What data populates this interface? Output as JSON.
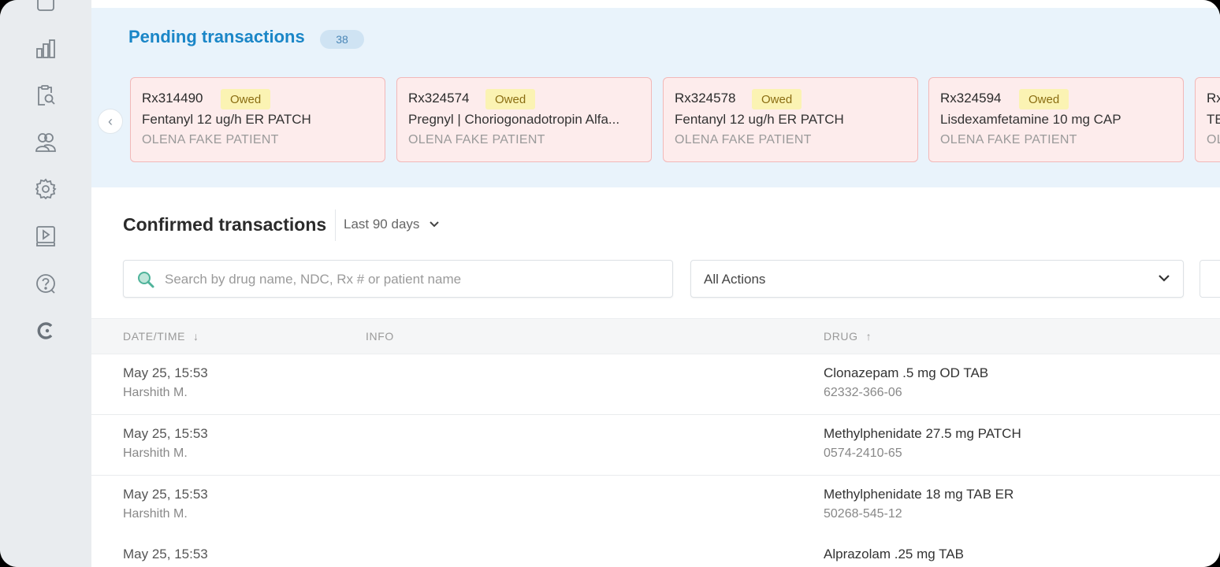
{
  "sidebar": {
    "icons": [
      "page-icon",
      "bar-chart-icon",
      "clipboard-search-icon",
      "users-icon",
      "gear-icon",
      "video-book-icon",
      "help-icon",
      "brand-logo-icon"
    ]
  },
  "pending": {
    "title": "Pending transactions",
    "count": "38",
    "cards": [
      {
        "rx": "Rx314490",
        "status": "Owed",
        "drug": "Fentanyl 12 ug/h ER PATCH",
        "patient": "OLENA FAKE PATIENT"
      },
      {
        "rx": "Rx324574",
        "status": "Owed",
        "drug": "Pregnyl | Choriogonadotropin Alfa...",
        "patient": "OLENA FAKE PATIENT"
      },
      {
        "rx": "Rx324578",
        "status": "Owed",
        "drug": "Fentanyl 12 ug/h ER PATCH",
        "patient": "OLENA FAKE PATIENT"
      },
      {
        "rx": "Rx324594",
        "status": "Owed",
        "drug": "Lisdexamfetamine 10 mg CAP",
        "patient": "OLENA FAKE PATIENT"
      },
      {
        "rx": "Rx",
        "status": "",
        "drug": "TE",
        "patient": "OL"
      }
    ]
  },
  "confirmed": {
    "title": "Confirmed transactions",
    "range": "Last 90 days",
    "search_placeholder": "Search by drug name, NDC, Rx # or patient name",
    "actions_filter": "All Actions",
    "columns": {
      "datetime": "DATE/TIME",
      "info": "INFO",
      "drug": "DRUG"
    },
    "rows": [
      {
        "datetime": "May 25, 15:53",
        "user": "Harshith M.",
        "drug": "Clonazepam .5 mg OD TAB",
        "ndc": "62332-366-06"
      },
      {
        "datetime": "May 25, 15:53",
        "user": "Harshith M.",
        "drug": "Methylphenidate 27.5 mg PATCH",
        "ndc": "0574-2410-65"
      },
      {
        "datetime": "May 25, 15:53",
        "user": "Harshith M.",
        "drug": "Methylphenidate 18 mg TAB ER",
        "ndc": "50268-545-12"
      },
      {
        "datetime": "May 25, 15:53",
        "user": "",
        "drug": "Alprazolam .25 mg TAB",
        "ndc": ""
      }
    ]
  },
  "colors": {
    "accent": "#1a86c7",
    "owed_bg": "#fbf3b3",
    "card_bg": "#fdecec",
    "card_border": "#f2b8b8",
    "pending_bg": "#e9f3fb"
  }
}
